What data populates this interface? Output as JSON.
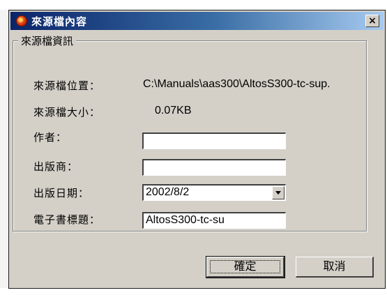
{
  "window": {
    "title": "來源檔內容",
    "close_label": "×"
  },
  "group": {
    "title": "來源檔資訊"
  },
  "fields": {
    "location_label": "來源檔位置：",
    "location_value": "C:\\Manuals\\aas300\\AltosS300-tc-sup.",
    "size_label": "來源檔大小：",
    "size_value": "0.07KB",
    "author_label": "作者：",
    "author_value": "",
    "publisher_label": "出版商：",
    "publisher_value": "",
    "date_label": "出版日期：",
    "date_value": "2002/8/2",
    "ebook_title_label": "電子書標題：",
    "ebook_title_value": "AltosS300-tc-su"
  },
  "buttons": {
    "ok": "確定",
    "cancel": "取消"
  }
}
